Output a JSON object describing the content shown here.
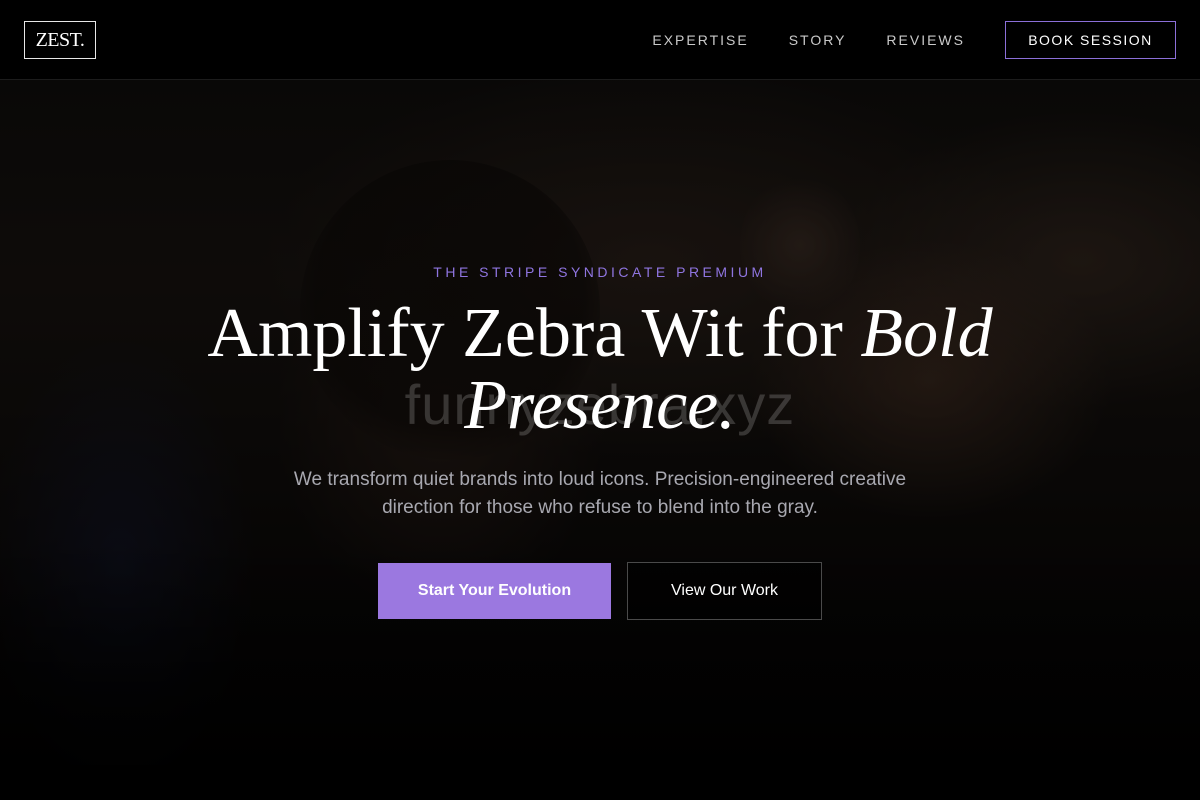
{
  "header": {
    "logo_text": "ZEST.",
    "nav": {
      "expertise": "EXPERTISE",
      "story": "STORY",
      "reviews": "REVIEWS"
    },
    "cta_label": "BOOK SESSION"
  },
  "hero": {
    "watermark": "funnyzebra.xyz",
    "eyebrow": "THE STRIPE SYNDICATE PREMIUM",
    "headline_plain": "Amplify Zebra Wit for ",
    "headline_italic": "Bold Presence.",
    "subtext": "We transform quiet brands into loud icons. Precision-engineered creative direction for those who refuse to blend into the gray.",
    "primary_cta": "Start Your Evolution",
    "secondary_cta": "View Our Work"
  },
  "colors": {
    "accent": "#9b78e0",
    "eyebrow": "#8f75e0",
    "cta_border": "#8b6fd8",
    "background": "#050505"
  }
}
